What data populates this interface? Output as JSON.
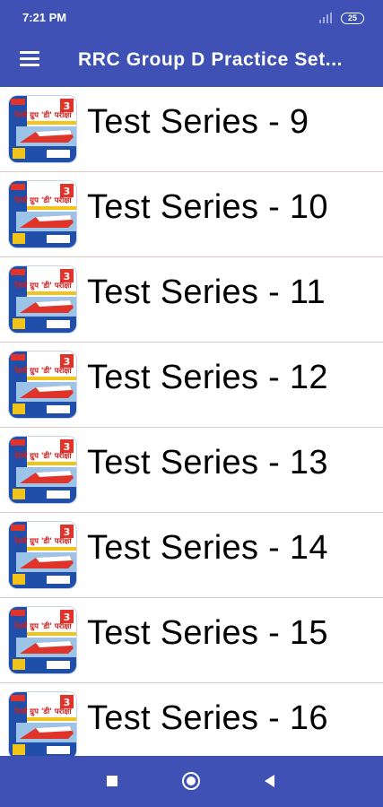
{
  "status_bar": {
    "time": "7:21 PM",
    "battery_level": "25"
  },
  "app_bar": {
    "menu_icon": "hamburger-menu-icon",
    "title": "RRC Group D Practice Set..."
  },
  "list": {
    "items": [
      {
        "title": "Test Series - 9",
        "thumbnail_text": "रेलवे ग्रुप 'डी' परीक्षा",
        "badge": "3"
      },
      {
        "title": "Test Series - 10",
        "thumbnail_text": "रेलवे ग्रुप 'डी' परीक्षा",
        "badge": "3"
      },
      {
        "title": "Test Series - 11",
        "thumbnail_text": "रेलवे ग्रुप 'डी' परीक्षा",
        "badge": "3"
      },
      {
        "title": "Test Series - 12",
        "thumbnail_text": "रेलवे ग्रुप 'डी' परीक्षा",
        "badge": "3"
      },
      {
        "title": "Test Series - 13",
        "thumbnail_text": "रेलवे ग्रुप 'डी' परीक्षा",
        "badge": "3"
      },
      {
        "title": "Test Series - 14",
        "thumbnail_text": "रेलवे ग्रुप 'डी' परीक्षा",
        "badge": "3"
      },
      {
        "title": "Test Series - 15",
        "thumbnail_text": "रेलवे ग्रुप 'डी' परीक्षा",
        "badge": "3"
      },
      {
        "title": "Test Series - 16",
        "thumbnail_text": "रेलवे ग्रुप 'डी' परीक्षा",
        "badge": "3"
      }
    ]
  },
  "nav_bar": {
    "recents_icon": "square-recents-icon",
    "home_icon": "circle-home-icon",
    "back_icon": "triangle-back-icon"
  },
  "colors": {
    "primary": "#3f51b5",
    "divider": "#e3c8c8",
    "text": "#000000"
  }
}
